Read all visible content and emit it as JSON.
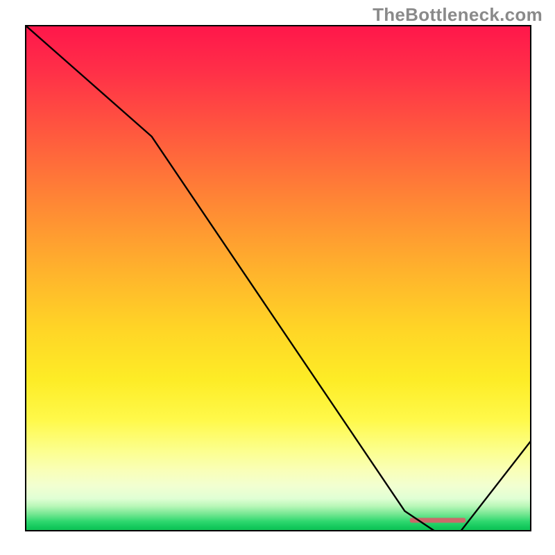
{
  "watermark": "TheBottleneck.com",
  "chart_data": {
    "type": "line",
    "title": "",
    "xlabel": "",
    "ylabel": "",
    "xlim": [
      0,
      100
    ],
    "ylim": [
      0,
      100
    ],
    "grid": false,
    "series": [
      {
        "name": "curve",
        "x": [
          0,
          25,
          75,
          81,
          86,
          100
        ],
        "values": [
          100,
          78,
          4,
          0,
          0,
          18
        ]
      }
    ],
    "marker": {
      "name": "valley-marker",
      "x_start": 76,
      "x_end": 87,
      "y": 2.2,
      "color": "#cb6a6a"
    },
    "background_gradient": {
      "top": "#ff164b",
      "upper_mid": "#ffb42c",
      "lower_mid": "#fff94a",
      "bottom": "#0fbf52"
    }
  }
}
